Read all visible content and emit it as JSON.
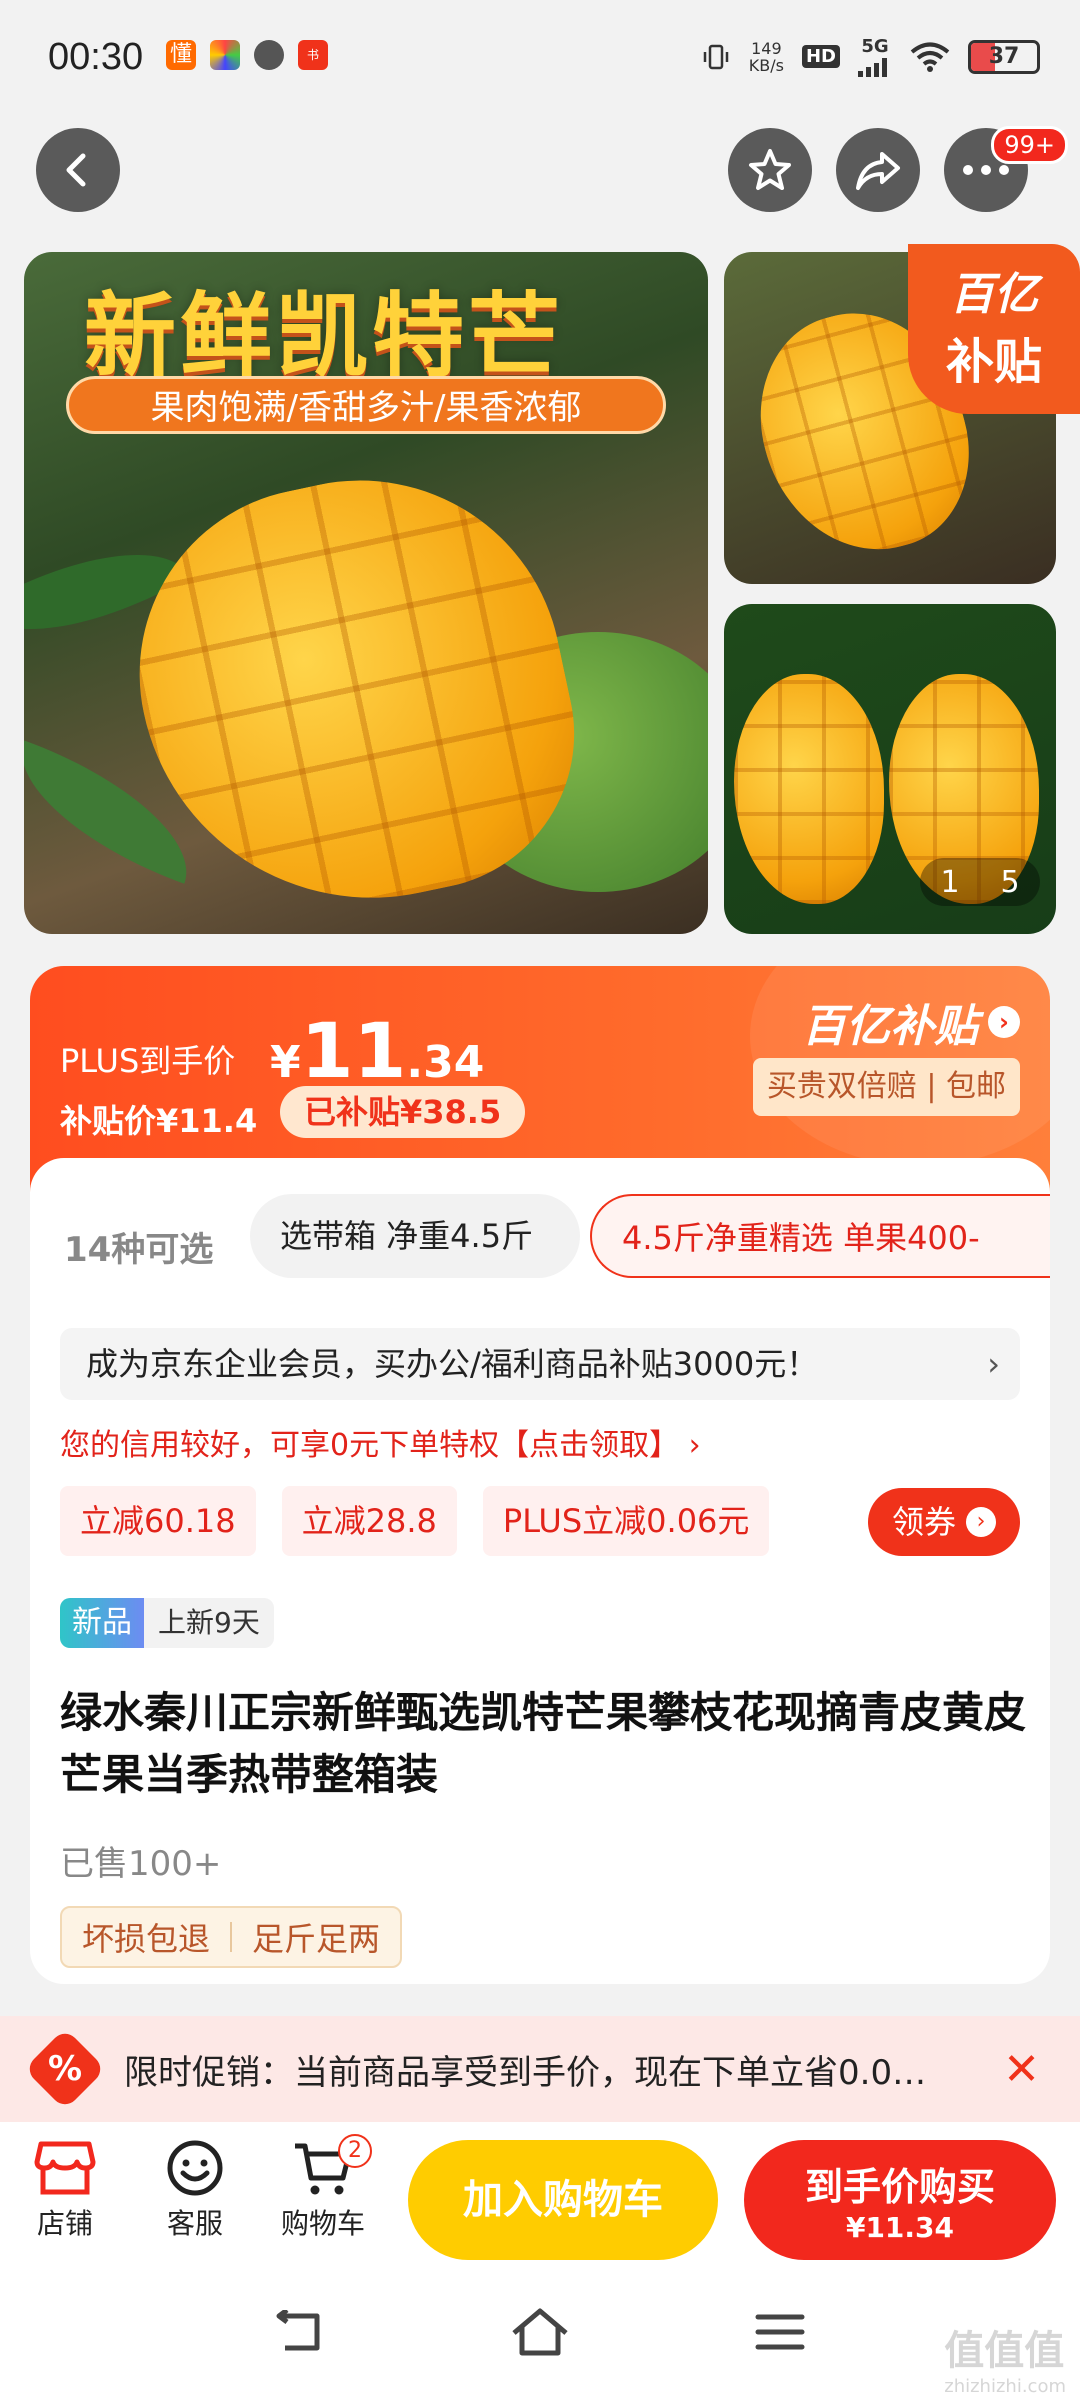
{
  "status_bar": {
    "time": "00:30",
    "speed_value": "149",
    "speed_unit": "KB/s",
    "hd": "HD",
    "network": "5G",
    "battery": "37"
  },
  "top_nav": {
    "more_badge": "99+"
  },
  "gallery": {
    "banner_title": "新鲜凯特芒",
    "banner_subtitle": "果肉饱满/香甜多汁/果香浓郁",
    "subsidy_brand": "百亿",
    "subsidy_text": "补贴",
    "page_current": "1",
    "page_total": "5"
  },
  "price": {
    "plus_label": "PLUS到手价",
    "currency": "¥",
    "plus_int": "11",
    "plus_dec": ".34",
    "subsidy_price_label": "补贴价¥11.4",
    "subsidized_pill": "已补贴¥38.5",
    "brand": "百亿补贴",
    "brand_arrow": "›",
    "guarantee": "买贵双倍赔 | 包邮"
  },
  "variants": {
    "count_label": "14种可选",
    "items": [
      "选带箱 净重4.5斤",
      "4.5斤净重精选 单果400-"
    ]
  },
  "promotions": {
    "enterprise": "成为京东企业会员，买办公/福利商品补贴3000元！",
    "enterprise_chevron": "›",
    "credit": "您的信用较好，可享0元下单特权【点击领取】 ›",
    "coupons": [
      "立减60.18",
      "立减28.8",
      "PLUS立减0.06元"
    ],
    "claim_label": "领券",
    "claim_arrow": "›"
  },
  "product": {
    "new_tag": "新品",
    "new_days": "上新9天",
    "title": "绿水秦川正宗新鲜甄选凯特芒果攀枝花现摘青皮黄皮芒果当季热带整箱装",
    "sold": "已售100+",
    "services": [
      "坏损包退",
      "足斤足两"
    ]
  },
  "promo_banner": {
    "icon": "%",
    "text": "限时促销：当前商品享受到手价，现在下单立省0.0…",
    "close": "✕"
  },
  "bottom_bar": {
    "shop": "店铺",
    "service": "客服",
    "cart": "购物车",
    "cart_count": "2",
    "add_to_cart": "加入购物车",
    "buy_label": "到手价购买",
    "buy_price": "¥11.34"
  },
  "watermark": {
    "main": "值值值",
    "sub": "zhizhizhi.com"
  },
  "colors": {
    "accent_red": "#f2281d",
    "accent_orange": "#ff5a1f",
    "cart_yellow": "#ffcc00"
  }
}
